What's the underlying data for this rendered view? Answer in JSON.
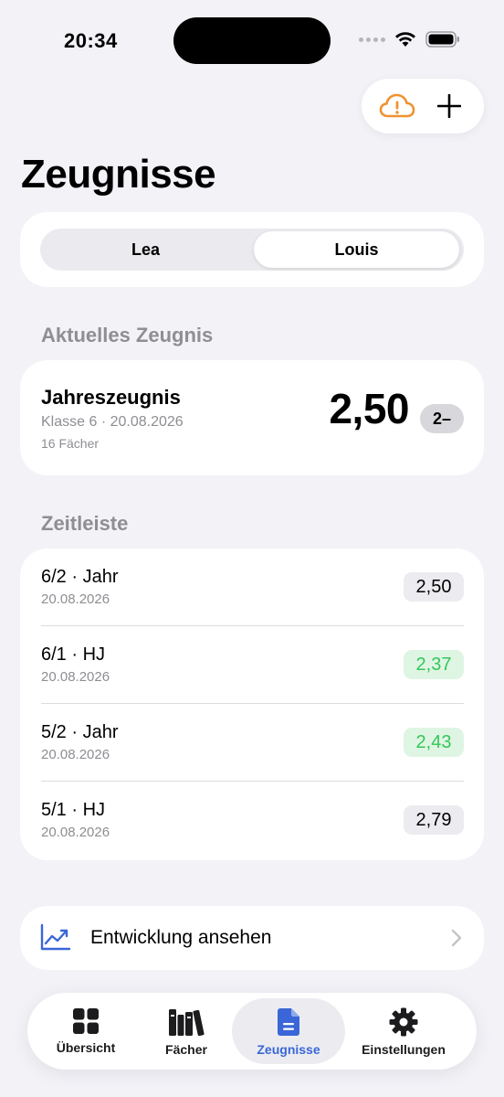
{
  "status": {
    "time": "20:34"
  },
  "header": {
    "title": "Zeugnisse"
  },
  "students": {
    "items": [
      "Lea",
      "Louis"
    ],
    "selected": "Louis"
  },
  "current": {
    "section_label": "Aktuelles Zeugnis",
    "title": "Jahreszeugnis",
    "subtitle": "Klasse 6 · 20.08.2026",
    "subjects": "16 Fächer",
    "average": "2,50",
    "grade": "2–"
  },
  "timeline": {
    "section_label": "Zeitleiste",
    "rows": [
      {
        "title": "6/2 · Jahr",
        "date": "20.08.2026",
        "grade": "2,50",
        "status": "neutral"
      },
      {
        "title": "6/1 · HJ",
        "date": "20.08.2026",
        "grade": "2,37",
        "status": "good"
      },
      {
        "title": "5/2 · Jahr",
        "date": "20.08.2026",
        "grade": "2,43",
        "status": "good"
      },
      {
        "title": "5/1 · HJ",
        "date": "20.08.2026",
        "grade": "2,79",
        "status": "neutral"
      }
    ]
  },
  "development": {
    "label": "Entwicklung ansehen"
  },
  "tabs": [
    {
      "label": "Übersicht",
      "icon": "grid-icon"
    },
    {
      "label": "Fächer",
      "icon": "books-icon"
    },
    {
      "label": "Zeugnisse",
      "icon": "document-icon",
      "active": true
    },
    {
      "label": "Einstellungen",
      "icon": "gear-icon"
    }
  ],
  "colors": {
    "accent": "#3a66d8",
    "warning": "#f0922e",
    "good": "#34c759"
  }
}
